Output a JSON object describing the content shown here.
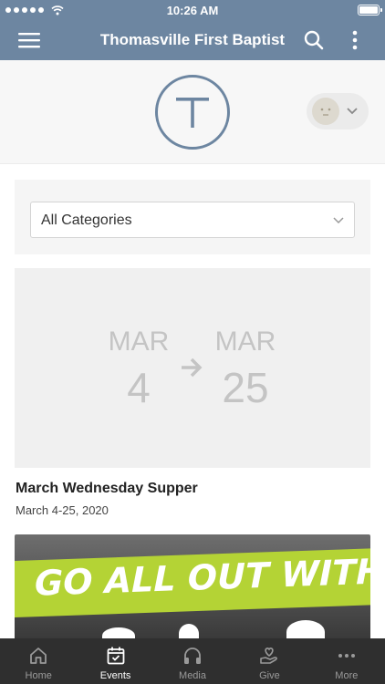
{
  "status_bar": {
    "time": "10:26 AM"
  },
  "header": {
    "title": "Thomasville First Baptist"
  },
  "filter": {
    "selected": "All Categories"
  },
  "featured_event": {
    "start_month": "MAR",
    "start_day": "4",
    "end_month": "MAR",
    "end_day": "25",
    "title": "March Wednesday Supper",
    "dates": "March 4-25, 2020"
  },
  "promo": {
    "text": "GO ALL OUT WITH"
  },
  "tabs": [
    {
      "label": "Home",
      "icon": "home-icon",
      "active": false
    },
    {
      "label": "Events",
      "icon": "calendar-check-icon",
      "active": true
    },
    {
      "label": "Media",
      "icon": "headphones-icon",
      "active": false
    },
    {
      "label": "Give",
      "icon": "hand-heart-icon",
      "active": false
    },
    {
      "label": "More",
      "icon": "ellipsis-icon",
      "active": false
    }
  ],
  "colors": {
    "header": "#6d86a1",
    "accent_green": "#b4d335",
    "tab_bar": "#2f2f2f"
  }
}
